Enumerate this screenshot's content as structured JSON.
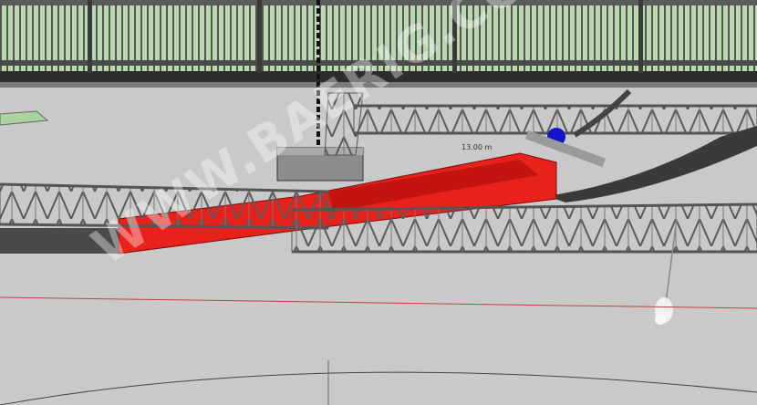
{
  "scene": {
    "dimension_label": "13.00 m",
    "watermark": "WWW.BAERIG.COM"
  },
  "colors": {
    "background": "#c9c9c9",
    "truss": "#6d6d6d",
    "red_panel": "#e8211c",
    "dark_track": "#3a3a3a",
    "grid_green": "#a9d4a0"
  }
}
